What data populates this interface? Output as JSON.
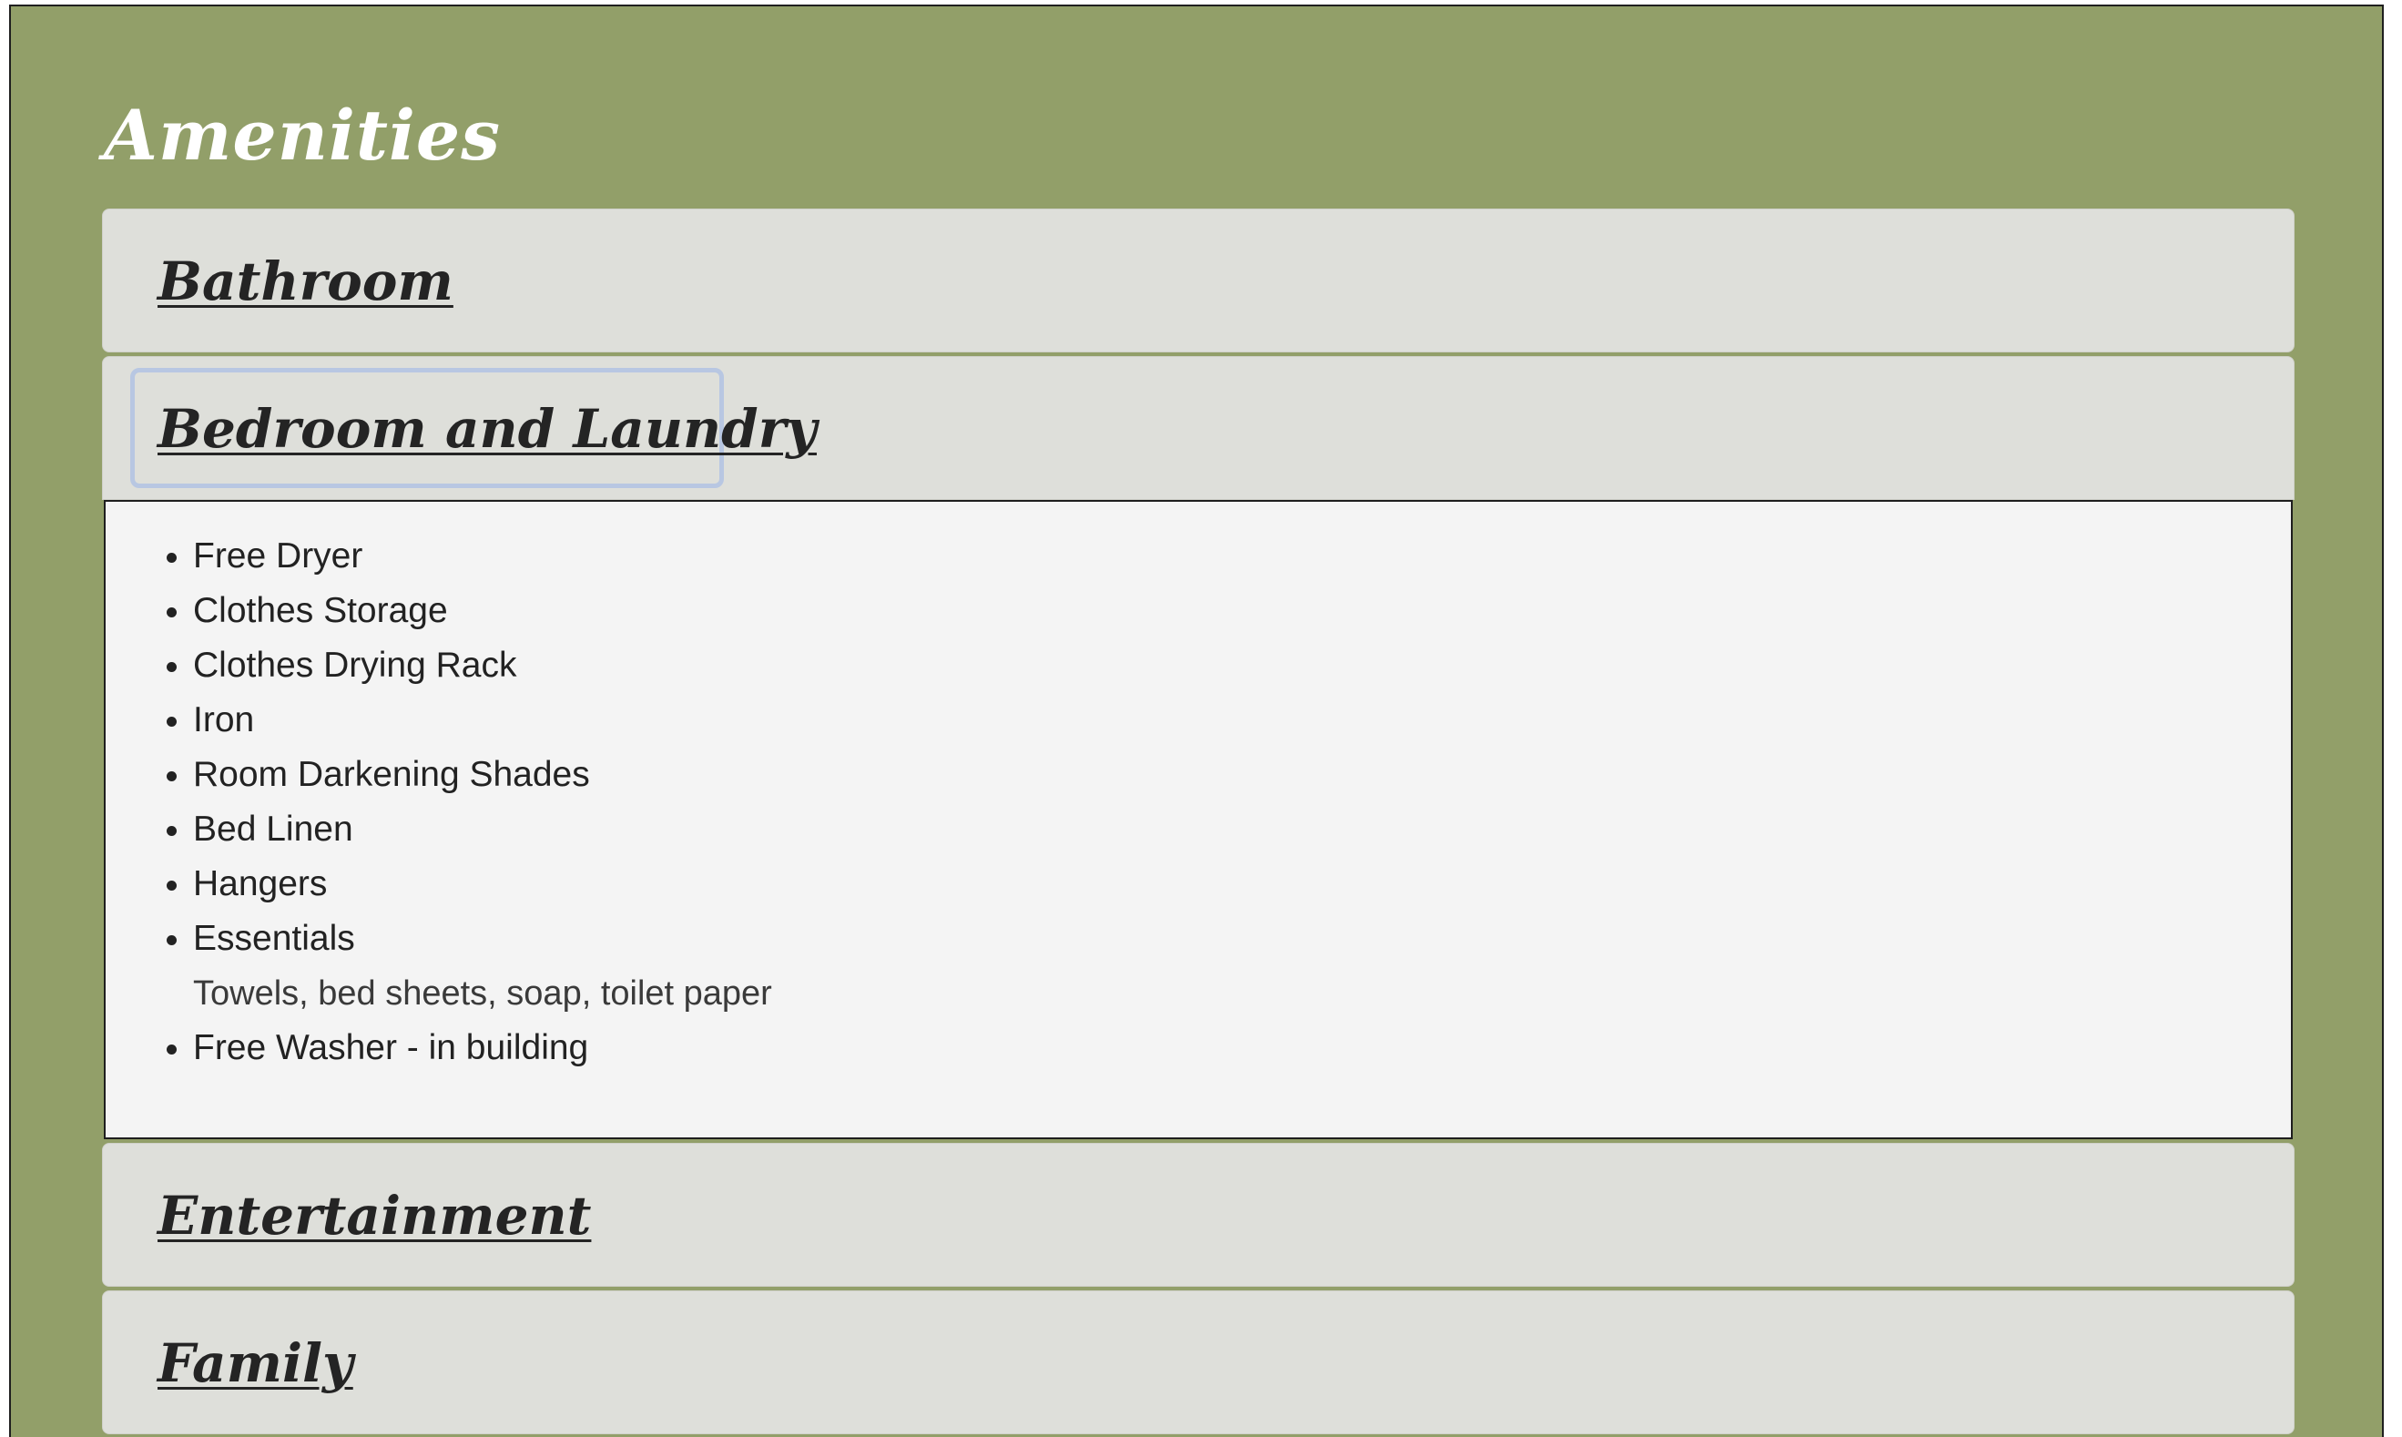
{
  "page": {
    "title": "Amenities"
  },
  "accordion": {
    "sections": [
      {
        "label": "Bathroom",
        "expanded": false
      },
      {
        "label": "Bedroom and Laundry",
        "expanded": true,
        "focused": true,
        "items": [
          {
            "label": "Free Dryer"
          },
          {
            "label": "Clothes Storage"
          },
          {
            "label": "Clothes Drying Rack"
          },
          {
            "label": "Iron"
          },
          {
            "label": "Room Darkening Shades"
          },
          {
            "label": "Bed Linen"
          },
          {
            "label": "Hangers"
          },
          {
            "label": "Essentials",
            "note": "Towels, bed sheets, soap, toilet paper"
          },
          {
            "label": "Free Washer - in building"
          }
        ]
      },
      {
        "label": "Entertainment",
        "expanded": false
      },
      {
        "label": "Family",
        "expanded": false
      }
    ]
  },
  "colors": {
    "page_background": "#929f69",
    "header_background": "#dedfda",
    "panel_background": "#f4f4f4",
    "focus_ring": "#b8c7e2",
    "title_text": "#ffffff",
    "link_text": "#242424"
  }
}
